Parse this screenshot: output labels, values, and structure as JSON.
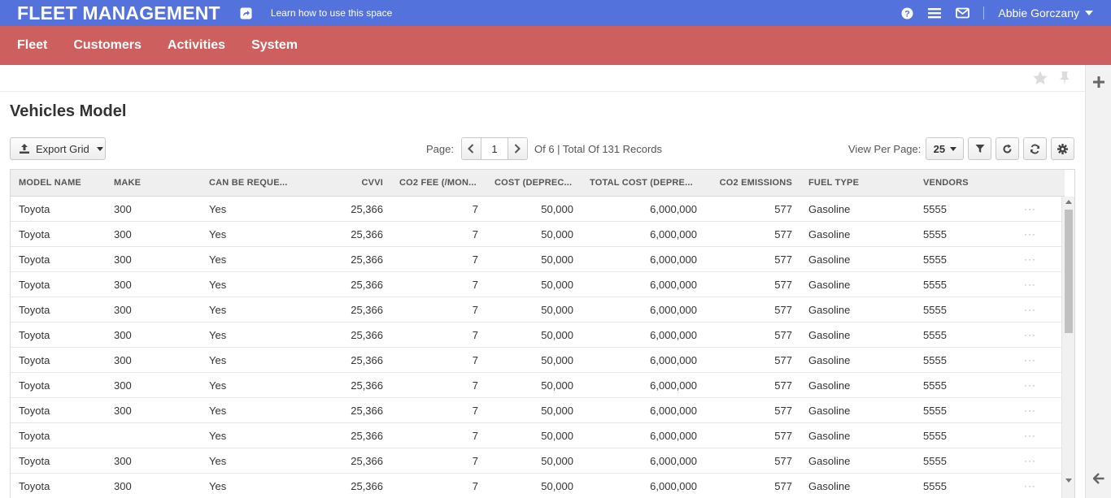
{
  "header": {
    "app_title": "FLEET MANAGEMENT",
    "learn_link": "Learn how to use this space",
    "user_name": "Abbie Gorczany",
    "icons": [
      "share-icon",
      "help-icon",
      "menu-icon",
      "mail-icon"
    ],
    "color": "#5472dc"
  },
  "nav": {
    "color": "#cd5f5f",
    "items": [
      "Fleet",
      "Customers",
      "Activities",
      "System"
    ]
  },
  "page": {
    "title": "Vehicles Model"
  },
  "toolbar": {
    "export_label": "Export Grid",
    "page_label": "Page:",
    "page_value": "1",
    "page_of": "Of 6 | Total Of 131 Records",
    "view_per_page_label": "View Per Page:",
    "view_per_page_value": "25"
  },
  "grid": {
    "columns": [
      "MODEL NAME",
      "MAKE",
      "CAN BE REQUE...",
      "CVVI",
      "CO2 FEE (/MON...",
      "COST (DEPREC...",
      "TOTAL COST (DEPRE...",
      "CO2 EMISSIONS",
      "FUEL TYPE",
      "VENDORS"
    ],
    "row_action": "···",
    "rows": [
      [
        "Toyota",
        "300",
        "Yes",
        "25,366",
        "7",
        "50,000",
        "6,000,000",
        "577",
        "Gasoline",
        "5555"
      ],
      [
        "Toyota",
        "300",
        "Yes",
        "25,366",
        "7",
        "50,000",
        "6,000,000",
        "577",
        "Gasoline",
        "5555"
      ],
      [
        "Toyota",
        "300",
        "Yes",
        "25,366",
        "7",
        "50,000",
        "6,000,000",
        "577",
        "Gasoline",
        "5555"
      ],
      [
        "Toyota",
        "300",
        "Yes",
        "25,366",
        "7",
        "50,000",
        "6,000,000",
        "577",
        "Gasoline",
        "5555"
      ],
      [
        "Toyota",
        "300",
        "Yes",
        "25,366",
        "7",
        "50,000",
        "6,000,000",
        "577",
        "Gasoline",
        "5555"
      ],
      [
        "Toyota",
        "300",
        "Yes",
        "25,366",
        "7",
        "50,000",
        "6,000,000",
        "577",
        "Gasoline",
        "5555"
      ],
      [
        "Toyota",
        "300",
        "Yes",
        "25,366",
        "7",
        "50,000",
        "6,000,000",
        "577",
        "Gasoline",
        "5555"
      ],
      [
        "Toyota",
        "300",
        "Yes",
        "25,366",
        "7",
        "50,000",
        "6,000,000",
        "577",
        "Gasoline",
        "5555"
      ],
      [
        "Toyota",
        "300",
        "Yes",
        "25,366",
        "7",
        "50,000",
        "6,000,000",
        "577",
        "Gasoline",
        "5555"
      ],
      [
        "Toyota",
        "",
        "Yes",
        "25,366",
        "7",
        "50,000",
        "6,000,000",
        "577",
        "Gasoline",
        "5555"
      ],
      [
        "Toyota",
        "300",
        "Yes",
        "25,366",
        "7",
        "50,000",
        "6,000,000",
        "577",
        "Gasoline",
        "5555"
      ],
      [
        "Toyota",
        "300",
        "Yes",
        "25,366",
        "7",
        "50,000",
        "6,000,000",
        "577",
        "Gasoline",
        "5555"
      ]
    ]
  }
}
